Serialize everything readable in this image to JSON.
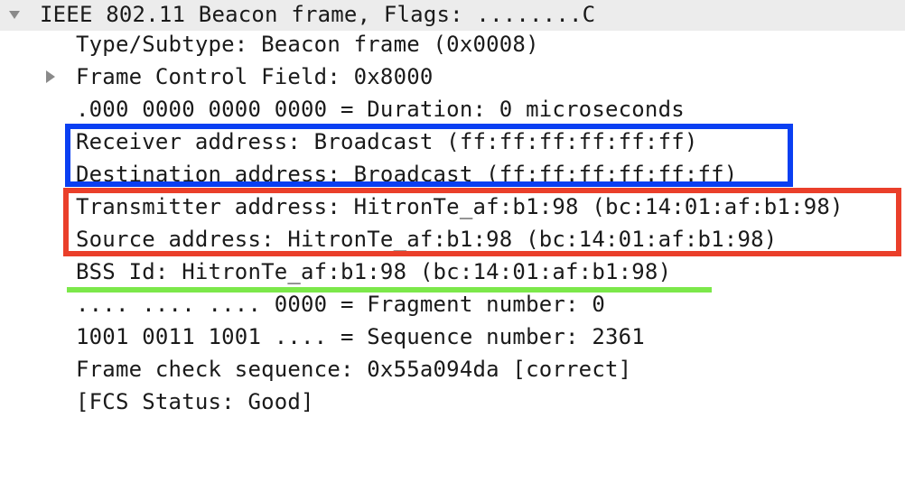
{
  "packet_details": {
    "header": {
      "label": "IEEE 802.11 Beacon frame, Flags: ........C",
      "expanded": true
    },
    "fields": [
      {
        "label": "Type/Subtype: Beacon frame (0x0008)",
        "has_children": false
      },
      {
        "label": "Frame Control Field: 0x8000",
        "has_children": true,
        "expanded": false
      },
      {
        "label": ".000 0000 0000 0000 = Duration: 0 microseconds",
        "has_children": false
      },
      {
        "label": "Receiver address: Broadcast (ff:ff:ff:ff:ff:ff)",
        "has_children": false
      },
      {
        "label": "Destination address: Broadcast (ff:ff:ff:ff:ff:ff)",
        "has_children": false
      },
      {
        "label": "Transmitter address: HitronTe_af:b1:98 (bc:14:01:af:b1:98)",
        "has_children": false
      },
      {
        "label": "Source address: HitronTe_af:b1:98 (bc:14:01:af:b1:98)",
        "has_children": false
      },
      {
        "label": "BSS Id: HitronTe_af:b1:98 (bc:14:01:af:b1:98)",
        "has_children": false
      },
      {
        "label": ".... .... .... 0000 = Fragment number: 0",
        "has_children": false
      },
      {
        "label": "1001 0011 1001 .... = Sequence number: 2361",
        "has_children": false
      },
      {
        "label": "Frame check sequence: 0x55a094da [correct]",
        "has_children": false
      },
      {
        "label": "[FCS Status: Good]",
        "has_children": false
      }
    ]
  },
  "annotations": {
    "blue_box_color": "#0a3ff2",
    "red_box_color": "#ea3f2a",
    "green_underline_color": "#7ce84a"
  },
  "colors": {
    "text": "#1a1a1a",
    "header_background": "#ececec",
    "toggle_arrow": "#8a8a8a"
  }
}
